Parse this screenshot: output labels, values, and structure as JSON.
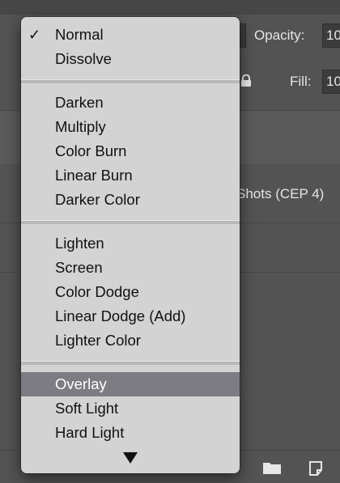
{
  "panel": {
    "opacity_label": "Opacity:",
    "opacity_value": "10",
    "fill_label": "Fill:",
    "fill_value": "10",
    "layer_name": "Shots (CEP 4)"
  },
  "blend_menu": {
    "selected": "Normal",
    "highlighted": "Overlay",
    "groups": [
      [
        "Normal",
        "Dissolve"
      ],
      [
        "Darken",
        "Multiply",
        "Color Burn",
        "Linear Burn",
        "Darker Color"
      ],
      [
        "Lighten",
        "Screen",
        "Color Dodge",
        "Linear Dodge (Add)",
        "Lighter Color"
      ],
      [
        "Overlay",
        "Soft Light",
        "Hard Light"
      ]
    ],
    "check_glyph": "✓"
  }
}
